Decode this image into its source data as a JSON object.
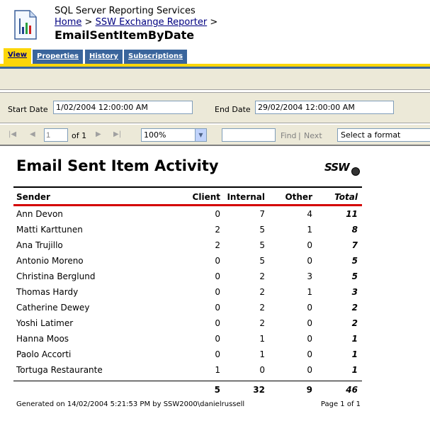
{
  "header": {
    "app_title": "SQL Server Reporting Services",
    "breadcrumb": [
      {
        "label": "Home"
      },
      {
        "label": "SSW Exchange Reporter"
      }
    ],
    "breadcrumb_separator": ">",
    "page_title": "EmailSentItemByDate"
  },
  "tabs": [
    {
      "label": "View",
      "active": true
    },
    {
      "label": "Properties",
      "active": false
    },
    {
      "label": "History",
      "active": false
    },
    {
      "label": "Subscriptions",
      "active": false
    }
  ],
  "parameters": {
    "start_label": "Start Date",
    "start_value": "1/02/2004 12:00:00 AM",
    "end_label": "End Date",
    "end_value": "29/02/2004 12:00:00 AM"
  },
  "toolbar": {
    "page_value": "1",
    "of_label": "of 1",
    "zoom_value": "100%",
    "find_label": "Find",
    "separator": "|",
    "next_label": "Next",
    "format_value": "Select a format"
  },
  "report": {
    "title": "Email Sent Item Activity",
    "logo_text": "SSW",
    "columns": {
      "sender": "Sender",
      "client": "Client",
      "internal": "Internal",
      "other": "Other",
      "total": "Total"
    },
    "rows": [
      {
        "sender": "Ann Devon",
        "client": "0",
        "internal": "7",
        "other": "4",
        "total": "11"
      },
      {
        "sender": "Matti Karttunen",
        "client": "2",
        "internal": "5",
        "other": "1",
        "total": "8"
      },
      {
        "sender": "Ana Trujillo",
        "client": "2",
        "internal": "5",
        "other": "0",
        "total": "7"
      },
      {
        "sender": "Antonio Moreno",
        "client": "0",
        "internal": "5",
        "other": "0",
        "total": "5"
      },
      {
        "sender": "Christina Berglund",
        "client": "0",
        "internal": "2",
        "other": "3",
        "total": "5"
      },
      {
        "sender": "Thomas Hardy",
        "client": "0",
        "internal": "2",
        "other": "1",
        "total": "3"
      },
      {
        "sender": "Catherine Dewey",
        "client": "0",
        "internal": "2",
        "other": "0",
        "total": "2"
      },
      {
        "sender": "Yoshi Latimer",
        "client": "0",
        "internal": "2",
        "other": "0",
        "total": "2"
      },
      {
        "sender": "Hanna Moos",
        "client": "0",
        "internal": "1",
        "other": "0",
        "total": "1"
      },
      {
        "sender": "Paolo Accorti",
        "client": "0",
        "internal": "1",
        "other": "0",
        "total": "1"
      },
      {
        "sender": "Tortuga Restaurante",
        "client": "1",
        "internal": "0",
        "other": "0",
        "total": "1"
      }
    ],
    "totals": {
      "client": "5",
      "internal": "32",
      "other": "9",
      "total": "46"
    },
    "footer_generated": "Generated on 14/02/2004 5:21:53 PM by SSW2000\\danielrussell",
    "footer_page": "Page 1 of 1"
  }
}
